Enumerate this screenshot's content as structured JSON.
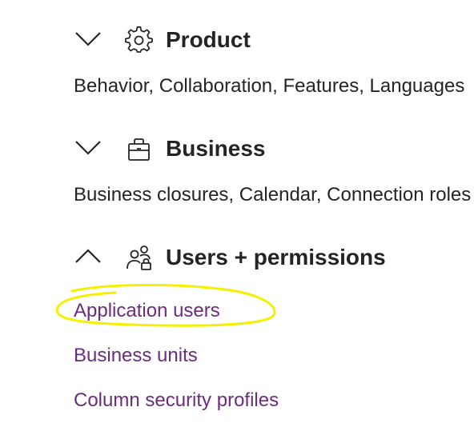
{
  "sections": [
    {
      "title": "Product",
      "description": "Behavior, Collaboration, Features, Languages",
      "icon": "gear-icon",
      "expanded": false
    },
    {
      "title": "Business",
      "description": "Business closures, Calendar, Connection roles",
      "icon": "briefcase-icon",
      "expanded": false
    },
    {
      "title": "Users + permissions",
      "icon": "users-lock-icon",
      "expanded": true,
      "links": [
        "Application users",
        "Business units",
        "Column security profiles"
      ]
    }
  ],
  "colors": {
    "text": "#242424",
    "link": "#6b2c7e",
    "highlight": "#f5f000"
  }
}
